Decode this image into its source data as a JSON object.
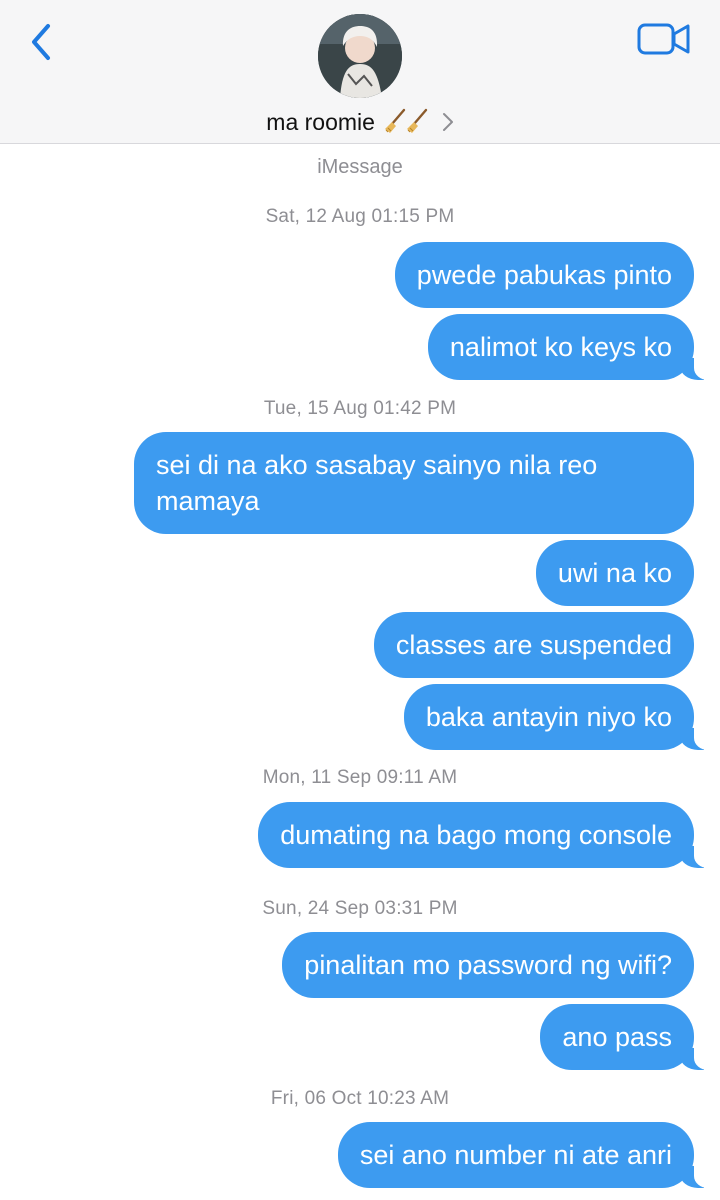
{
  "header": {
    "contact_name": "ma roomie",
    "back_icon": "chevron-left-icon",
    "video_icon": "video-camera-icon",
    "accent": "#1f7ae0"
  },
  "service_label": "iMessage",
  "bubble_color": "#3d9bf0",
  "thread": [
    {
      "timestamp": "Sat, 12 Aug 01:15 PM",
      "messages": [
        "pwede pabukas pinto",
        "nalimot ko keys ko"
      ]
    },
    {
      "timestamp": "Tue, 15 Aug 01:42 PM",
      "messages": [
        "sei di na ako sasabay sainyo nila reo mamaya",
        "uwi na ko",
        "classes are suspended",
        "baka antayin niyo ko"
      ]
    },
    {
      "timestamp": "Mon, 11 Sep 09:11 AM",
      "messages": [
        "dumating na bago mong console"
      ]
    },
    {
      "timestamp": "Sun, 24 Sep 03:31 PM",
      "messages": [
        "pinalitan mo password ng wifi?",
        "ano pass"
      ]
    },
    {
      "timestamp": "Fri, 06 Oct 10:23 AM",
      "messages": [
        "sei ano number ni ate anri"
      ]
    }
  ]
}
